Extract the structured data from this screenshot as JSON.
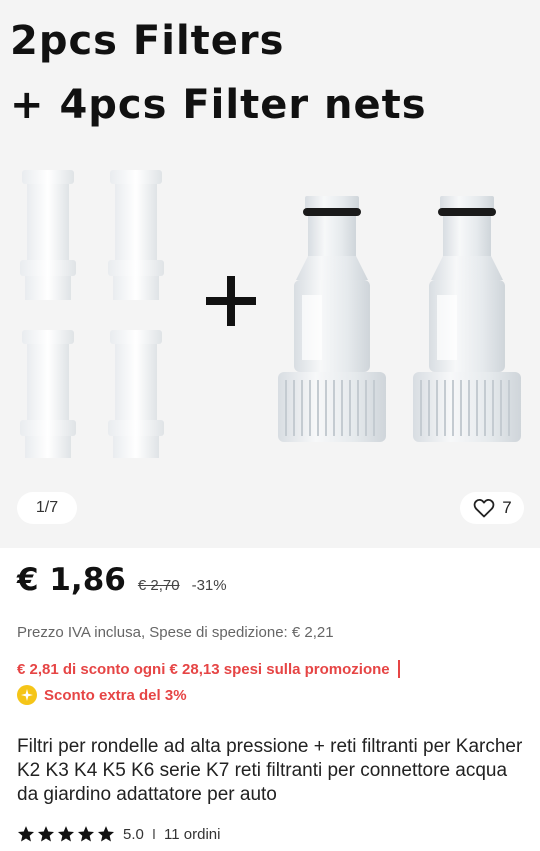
{
  "gallery": {
    "title_line1": "2pcs Filters",
    "title_line2": "+ 4pcs Filter nets",
    "image_counter": "1/7",
    "like_count": "7"
  },
  "price": {
    "current": "€ 1,86",
    "original": "€ 2,70",
    "discount": "-31%"
  },
  "tax_note": "Prezzo IVA inclusa, Spese di spedizione: € 2,21",
  "promo": {
    "discount_text": "€ 2,81 di sconto ogni € 28,13 spesi sulla promozione",
    "extra_text": "Sconto extra del 3%"
  },
  "product_title": "Filtri per rondelle ad alta pressione + reti filtranti per Karcher K2 K3 K4 K5 K6 serie K7 reti filtranti per connettore acqua da giardino adattatore per auto",
  "rating": {
    "score": "5.0",
    "separator": "I",
    "orders": "11 ordini"
  },
  "colors": {
    "accent_red": "#e64545",
    "coin_yellow": "#f5c518"
  },
  "icons": [
    "heart-icon",
    "coin-icon",
    "star-icon"
  ]
}
